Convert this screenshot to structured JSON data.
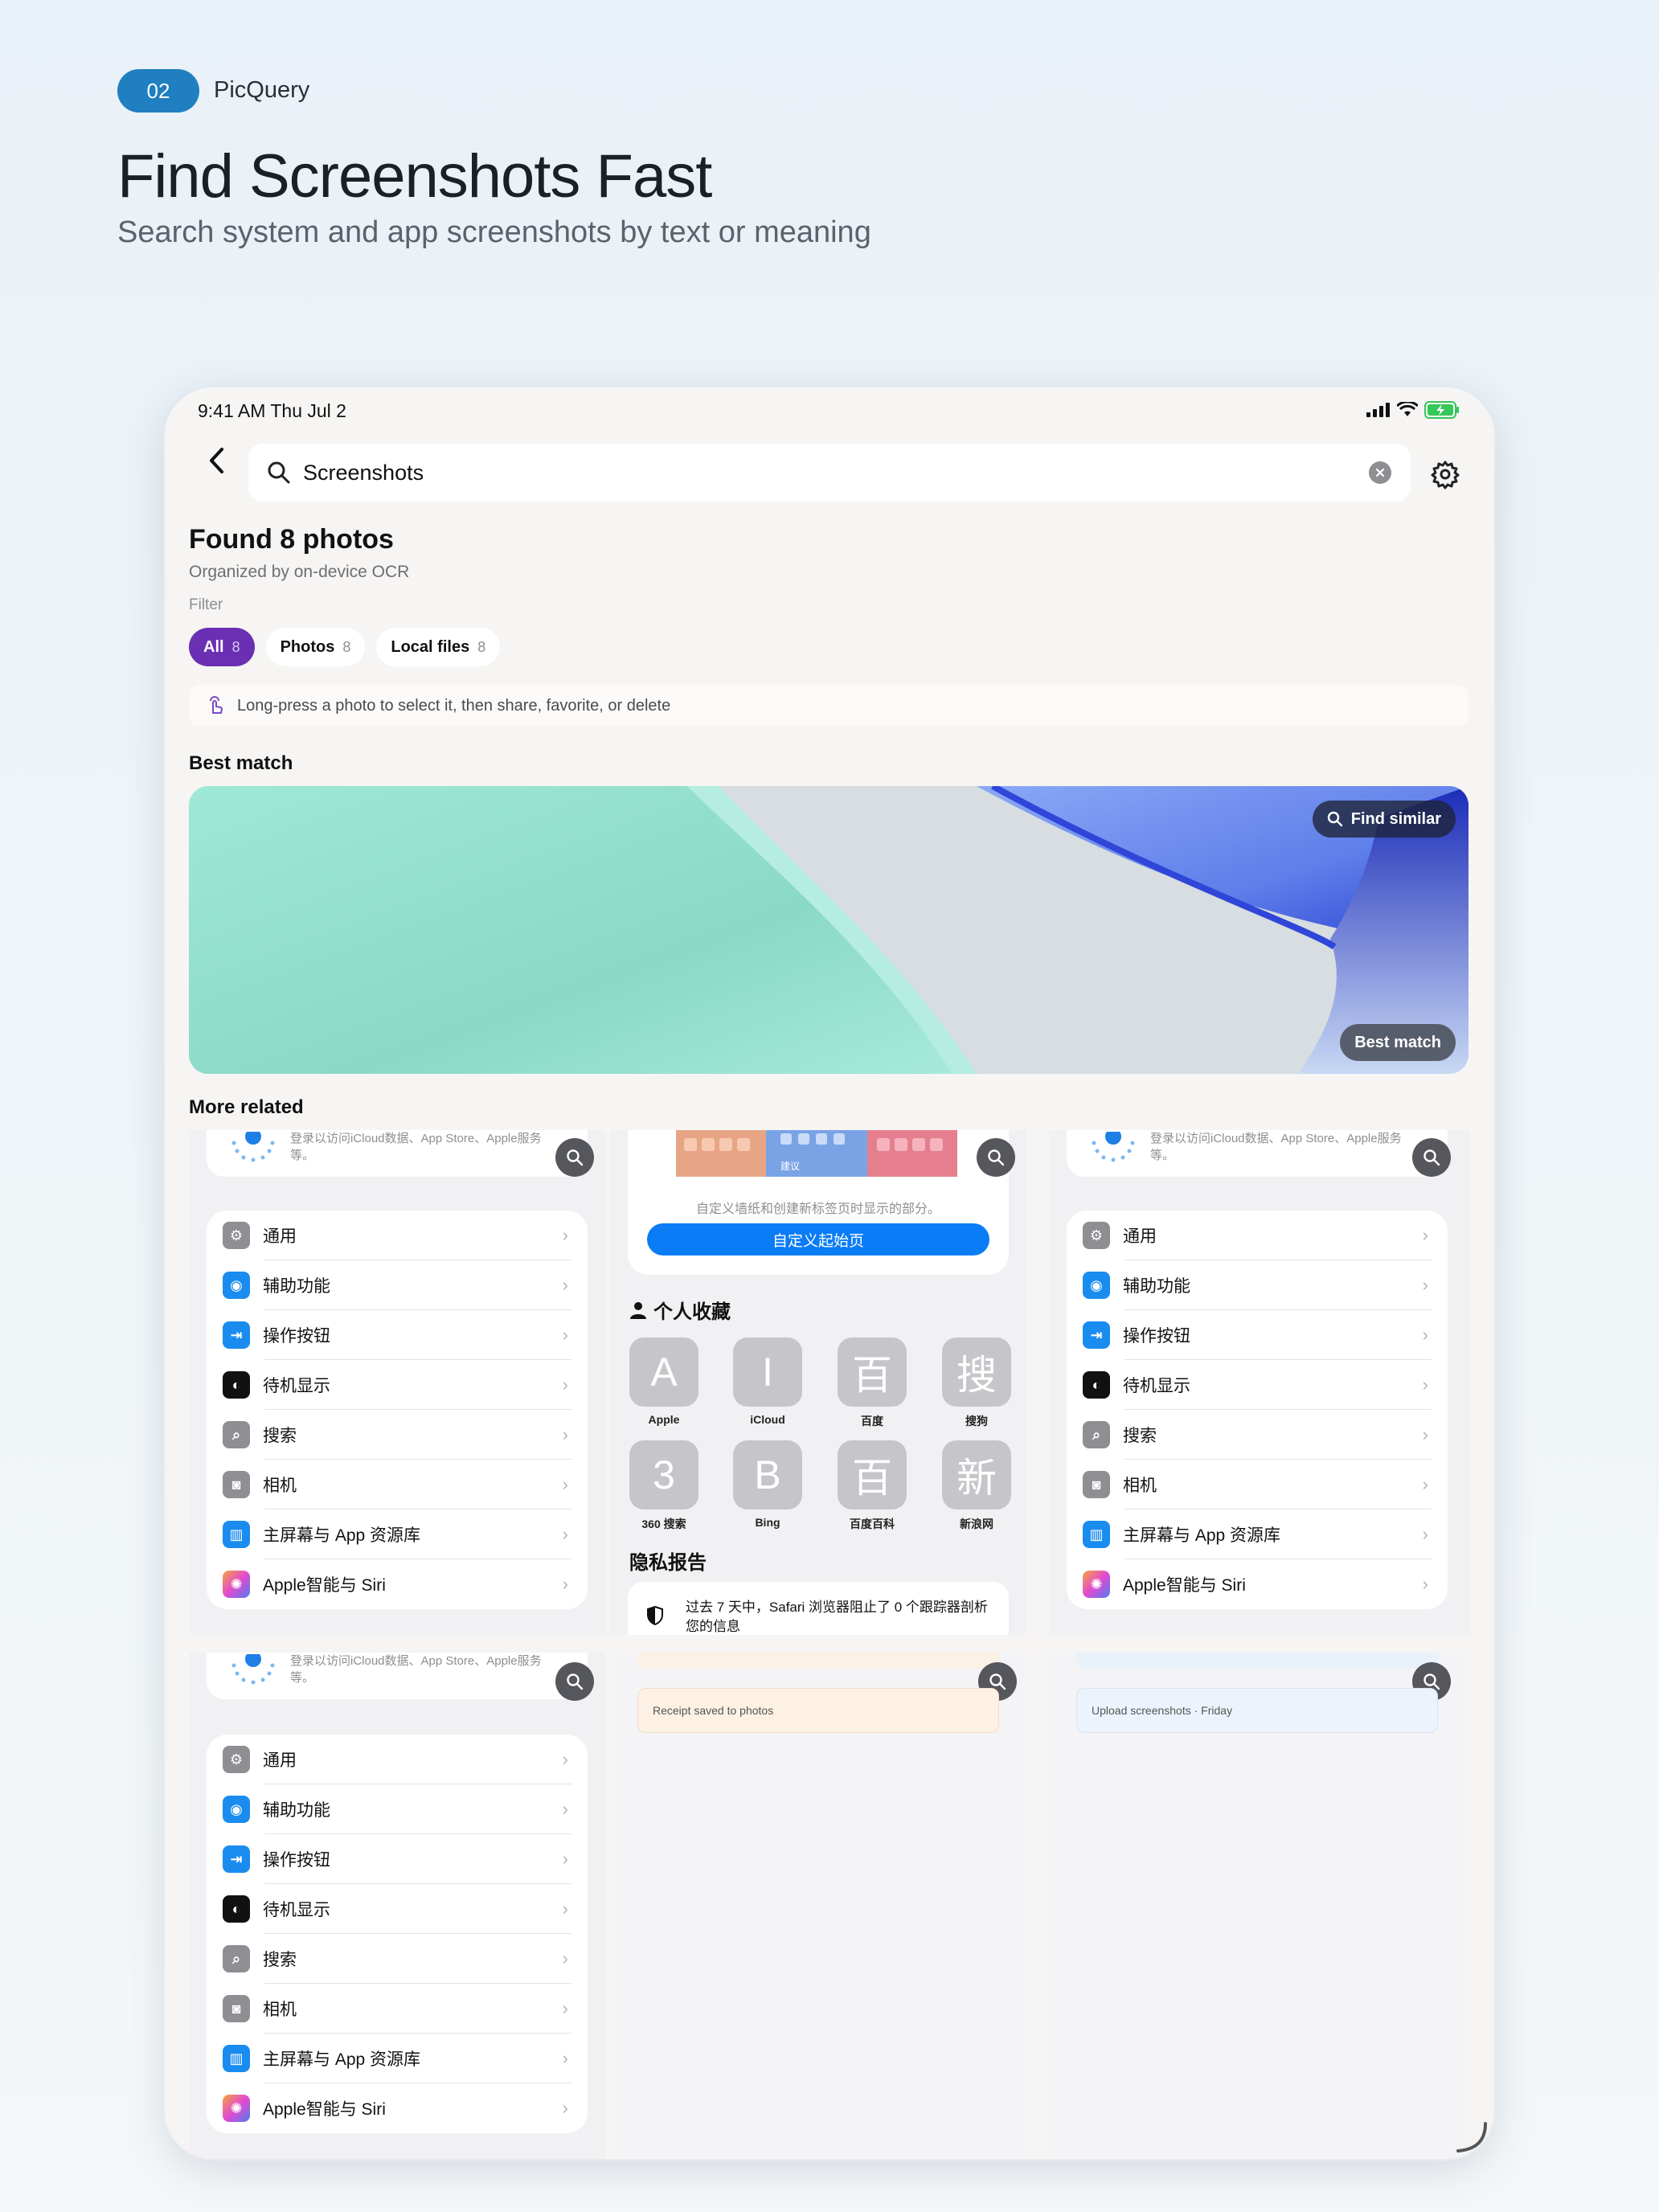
{
  "header": {
    "badge": "02",
    "app_name": "PicQuery",
    "title": "Find Screenshots Fast",
    "subtitle": "Search system and app screenshots by text or meaning"
  },
  "status_bar": {
    "time": "9:41 AM   Thu Jul 2"
  },
  "search": {
    "query": "Screenshots"
  },
  "results": {
    "title": "Found 8 photos",
    "subtitle": "Organized by on-device OCR",
    "filter_label": "Filter",
    "chips": [
      {
        "label": "All",
        "count": "8"
      },
      {
        "label": "Photos",
        "count": "8"
      },
      {
        "label": "Local files",
        "count": "8"
      }
    ],
    "hint": "Long-press a photo to select it, then share, favorite, or delete"
  },
  "best_match": {
    "section": "Best match",
    "find_similar": "Find similar",
    "badge": "Best match"
  },
  "more_related": {
    "section": "More related",
    "icloud_text": "登录以访问iCloud数据、App Store、Apple服务等。",
    "settings_rows": [
      {
        "label": "通用",
        "icon": "gear-icon",
        "color": "#8e8e93"
      },
      {
        "label": "辅助功能",
        "icon": "accessibility-icon",
        "color": "#1a8cf0"
      },
      {
        "label": "操作按钮",
        "icon": "action-button-icon",
        "color": "#1a8cf0"
      },
      {
        "label": "待机显示",
        "icon": "standby-icon",
        "color": "#111111"
      },
      {
        "label": "搜索",
        "icon": "search-icon",
        "color": "#8e8e93"
      },
      {
        "label": "相机",
        "icon": "camera-icon",
        "color": "#8e8e93"
      },
      {
        "label": "主屏幕与 App 资源库",
        "icon": "home-screen-icon",
        "color": "#1a8cf0"
      },
      {
        "label": "Apple智能与 Siri",
        "icon": "siri-icon",
        "color": "#e26ad0"
      }
    ],
    "safari": {
      "start_page_caption": "自定义墙纸和创建新标签页时显示的部分。",
      "start_page_button": "自定义起始页",
      "suggest": "建议",
      "favorites_title": "个人收藏",
      "favorites": [
        {
          "glyph": "A",
          "name": "Apple"
        },
        {
          "glyph": "I",
          "name": "iCloud"
        },
        {
          "glyph": "百",
          "name": "百度"
        },
        {
          "glyph": "搜",
          "name": "搜狗"
        },
        {
          "glyph": "3",
          "name": "360 搜索"
        },
        {
          "glyph": "B",
          "name": "Bing"
        },
        {
          "glyph": "百",
          "name": "百度百科"
        },
        {
          "glyph": "新",
          "name": "新浪网"
        }
      ],
      "privacy_title": "隐私报告",
      "privacy_text": "过去 7 天中，Safari 浏览器阻止了 0 个跟踪器剖析您的信息"
    },
    "receipt_note": "Receipt saved to photos",
    "upload_note": "Upload screenshots · Friday"
  }
}
